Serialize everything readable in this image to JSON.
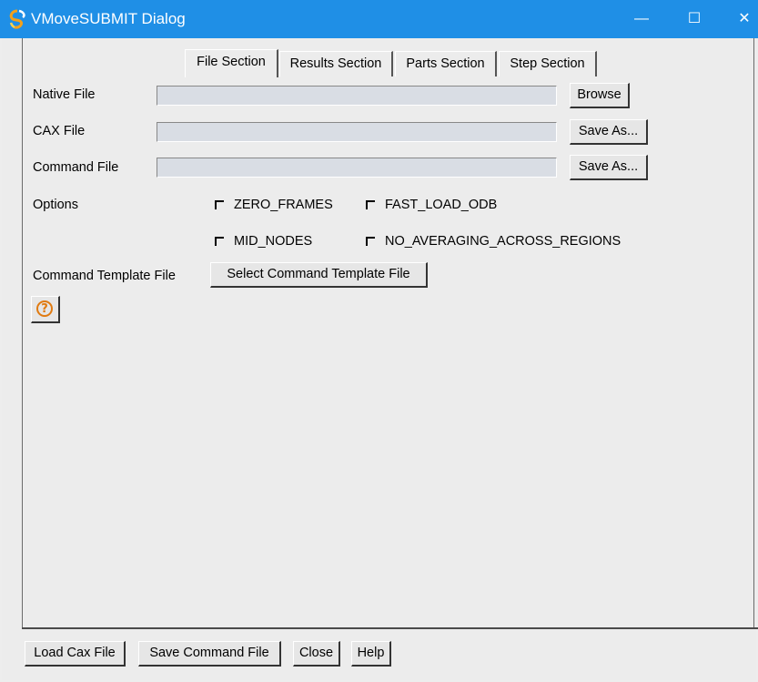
{
  "window": {
    "title": "VMoveSUBMIT Dialog",
    "minimize_glyph": "—",
    "maximize_glyph": "☐",
    "close_glyph": "✕"
  },
  "tabs": [
    {
      "label": "File Section",
      "active": true
    },
    {
      "label": "Results Section",
      "active": false
    },
    {
      "label": "Parts Section",
      "active": false
    },
    {
      "label": "Step Section",
      "active": false
    }
  ],
  "native_file": {
    "label": "Native File",
    "value": "",
    "button": "Browse"
  },
  "cax_file": {
    "label": "CAX File",
    "value": "",
    "button": "Save As..."
  },
  "command_file": {
    "label": "Command File",
    "value": "",
    "button": "Save As..."
  },
  "options": {
    "label": "Options",
    "items": [
      {
        "label": "ZERO_FRAMES",
        "checked": false
      },
      {
        "label": "FAST_LOAD_ODB",
        "checked": false
      },
      {
        "label": "MID_NODES",
        "checked": false
      },
      {
        "label": "NO_AVERAGING_ACROSS_REGIONS",
        "checked": false
      }
    ]
  },
  "template": {
    "label": "Command Template File",
    "button": "Select Command Template File"
  },
  "help_icon_glyph": "?",
  "footer": {
    "load_cax": "Load Cax File",
    "save_command": "Save Command File",
    "close": "Close",
    "help": "Help"
  },
  "colors": {
    "titlebar": "#1f8fe6",
    "background": "#ececec",
    "field": "#d9dde4",
    "help_icon": "#e07a10"
  },
  "icons": {
    "app": "app-logo-icon",
    "help": "question-circle-icon"
  }
}
